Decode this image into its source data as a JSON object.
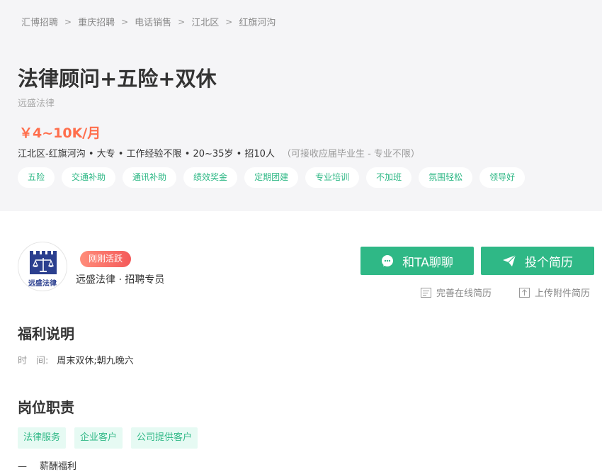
{
  "breadcrumb": [
    "汇博招聘",
    "重庆招聘",
    "电话销售",
    "江北区",
    "红旗河沟"
  ],
  "breadcrumb_sep": ">",
  "job": {
    "title": "法律顾问+五险+双休",
    "company": "远盛法律",
    "salary": "￥4~10K/月",
    "meta": "江北区-红旗河沟 • 大专 • 工作经验不限 • 20~35岁 • 招10人",
    "note": "（可接收应届毕业生 - 专业不限）",
    "benefit_tags": [
      "五险",
      "交通补助",
      "通讯补助",
      "绩效奖金",
      "定期团建",
      "专业培训",
      "不加班",
      "氛围轻松",
      "领导好"
    ]
  },
  "recruiter": {
    "logo_text": "远盛法律",
    "status_badge": "刚刚活跃",
    "name": "远盛法律 · 招聘专员"
  },
  "actions": {
    "chat_label": "和TA聊聊",
    "apply_label": "投个简历",
    "online_resume": "完善在线简历",
    "upload_resume": "上传附件简历"
  },
  "welfare": {
    "heading": "福利说明",
    "time_label": "时　间:",
    "time_value": "周末双休;朝九晚六"
  },
  "duty": {
    "heading": "岗位职责",
    "tags": [
      "法律服务",
      "企业客户",
      "公司提供客户"
    ],
    "partial_line": "薪酬福利"
  },
  "colors": {
    "accent": "#2fb886",
    "salary": "#ff6e4c",
    "logo_blue": "#2b3f8f"
  }
}
